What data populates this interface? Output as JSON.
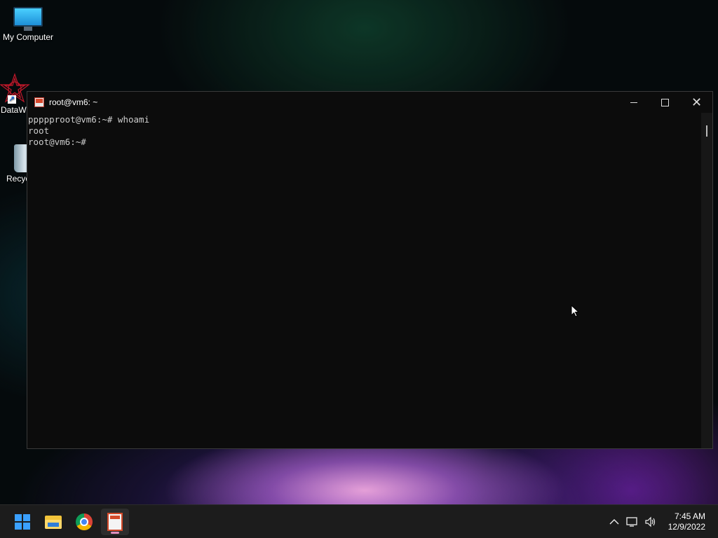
{
  "desktop": {
    "icons": [
      {
        "label": "My Computer"
      },
      {
        "label": "DataW"
      },
      {
        "label": "Recyc"
      }
    ]
  },
  "window": {
    "title": "root@vm6: ~",
    "controls": {
      "minimize": "minimize",
      "maximize": "maximize",
      "close": "close"
    }
  },
  "terminal": {
    "lines": [
      "ppppproot@vm6:~# whoami",
      "root",
      "root@vm6:~# "
    ]
  },
  "taskbar": {
    "apps": [
      "start-icon",
      "file-explorer-icon",
      "chrome-icon",
      "terminal-icon"
    ],
    "active_app": "terminal-icon"
  },
  "tray": {
    "time": "7:45 AM",
    "date": "12/9/2022"
  }
}
